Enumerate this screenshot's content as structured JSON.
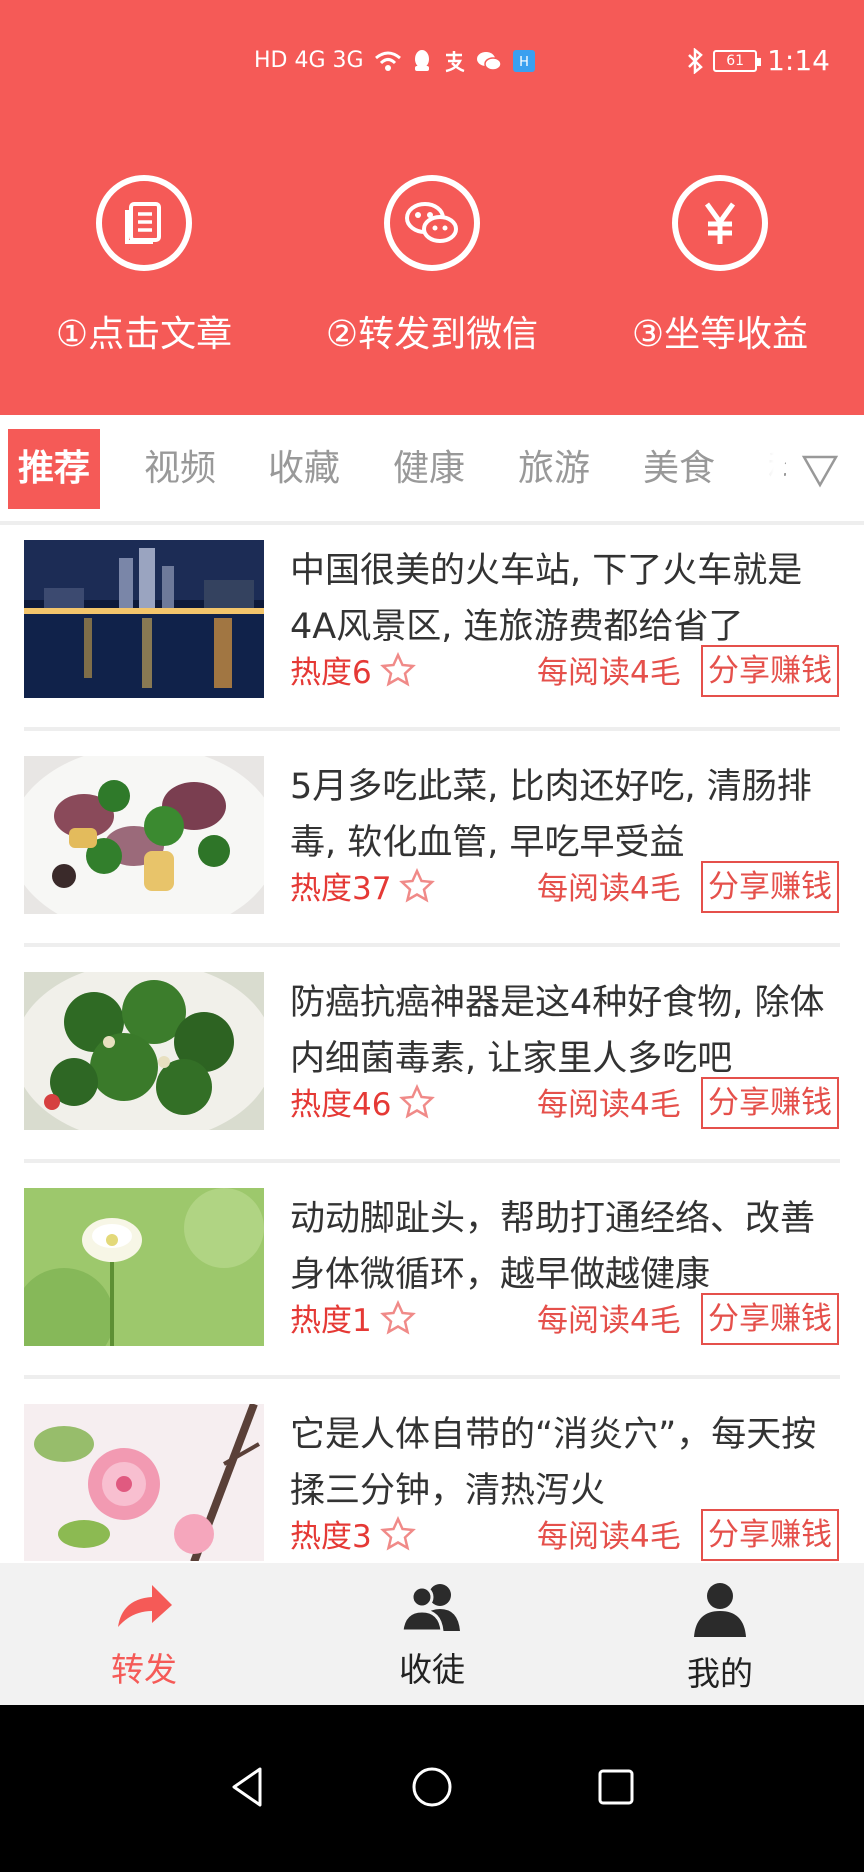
{
  "status_bar": {
    "left_indicators": "HD 4G 3G",
    "time": "1:14",
    "battery": "61"
  },
  "steps": [
    {
      "label": "①点击文章",
      "icon": "article-icon"
    },
    {
      "label": "②转发到微信",
      "icon": "wechat-icon"
    },
    {
      "label": "③坐等收益",
      "icon": "yuan-icon"
    }
  ],
  "tabs": {
    "items": [
      "推荐",
      "视频",
      "收藏",
      "健康",
      "旅游",
      "美食",
      "科"
    ],
    "active": "推荐"
  },
  "articles": [
    {
      "title": "中国很美的火车站, 下了火车就是4A风景区, 连旅游费都给省了",
      "heat": "热度6",
      "reward": "每阅读4毛",
      "share": "分享赚钱",
      "thumb": "night-city-thumb"
    },
    {
      "title": "5月多吃此菜, 比肉还好吃, 清肠排毒, 软化血管, 早吃早受益",
      "heat": "热度37",
      "reward": "每阅读4毛",
      "share": "分享赚钱",
      "thumb": "vegetable-dish-thumb"
    },
    {
      "title": "防癌抗癌神器是这4种好食物, 除体内细菌毒素, 让家里人多吃吧",
      "heat": "热度46",
      "reward": "每阅读4毛",
      "share": "分享赚钱",
      "thumb": "broccoli-thumb"
    },
    {
      "title": "动动脚趾头，帮助打通经络、改善身体微循环，越早做越健康",
      "heat": "热度1",
      "reward": "每阅读4毛",
      "share": "分享赚钱",
      "thumb": "white-flower-thumb"
    },
    {
      "title": "它是人体自带的“消炎穴”，每天按揉三分钟，清热泻火",
      "heat": "热度3",
      "reward": "每阅读4毛",
      "share": "分享赚钱",
      "thumb": "pink-blossom-thumb"
    }
  ],
  "bottom_nav": [
    {
      "label": "转发",
      "icon": "share-arrow-icon",
      "active": true
    },
    {
      "label": "收徒",
      "icon": "users-icon",
      "active": false
    },
    {
      "label": "我的",
      "icon": "profile-icon",
      "active": false
    }
  ],
  "colors": {
    "brand": "#f55a57",
    "heat": "#e53935",
    "tab_inactive": "#999999"
  }
}
